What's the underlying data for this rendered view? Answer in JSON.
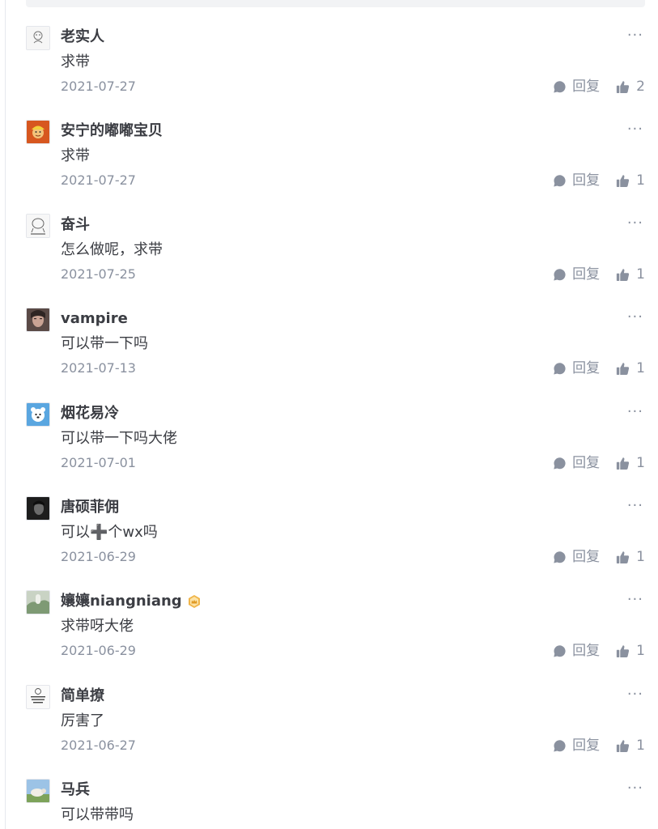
{
  "more_symbol": "···",
  "reply_label": "回复",
  "colors": {
    "text_primary": "#3b3d43",
    "text_secondary": "#8a919f",
    "icon": "#8a919f",
    "badge": "#f0b54a"
  },
  "comments": [
    {
      "username": "老实人",
      "text": "求带",
      "date": "2021-07-27",
      "likes": "2",
      "avatar_icon": "hand-drawn-figure-avatar"
    },
    {
      "username": "安宁的嘟嘟宝贝",
      "text": "求带",
      "date": "2021-07-27",
      "likes": "1",
      "avatar_icon": "cartoon-character-avatar"
    },
    {
      "username": "奋斗",
      "text": "怎么做呢，求带",
      "date": "2021-07-25",
      "likes": "1",
      "avatar_icon": "sketch-meme-avatar"
    },
    {
      "username": "vampire",
      "text": "可以带一下吗",
      "date": "2021-07-13",
      "likes": "1",
      "avatar_icon": "portrait-photo-avatar"
    },
    {
      "username": "烟花易冷",
      "text": "可以带一下吗大佬",
      "date": "2021-07-01",
      "likes": "1",
      "avatar_icon": "cartoon-bear-avatar"
    },
    {
      "username": "唐硕菲佣",
      "text": "可以➕个wx吗",
      "date": "2021-06-29",
      "likes": "1",
      "avatar_icon": "dark-portrait-avatar"
    },
    {
      "username": "孃孃niangniang",
      "text": "求带呀大佬",
      "date": "2021-06-29",
      "likes": "1",
      "avatar_icon": "nature-photo-avatar",
      "badge_icon": "level-crown-badge-icon"
    },
    {
      "username": "简单撩",
      "text": "厉害了",
      "date": "2021-06-27",
      "likes": "1",
      "avatar_icon": "text-meme-avatar"
    },
    {
      "username": "马兵",
      "text": "可以带带吗",
      "date": "",
      "likes": "",
      "avatar_icon": "sheep-photo-avatar"
    }
  ]
}
